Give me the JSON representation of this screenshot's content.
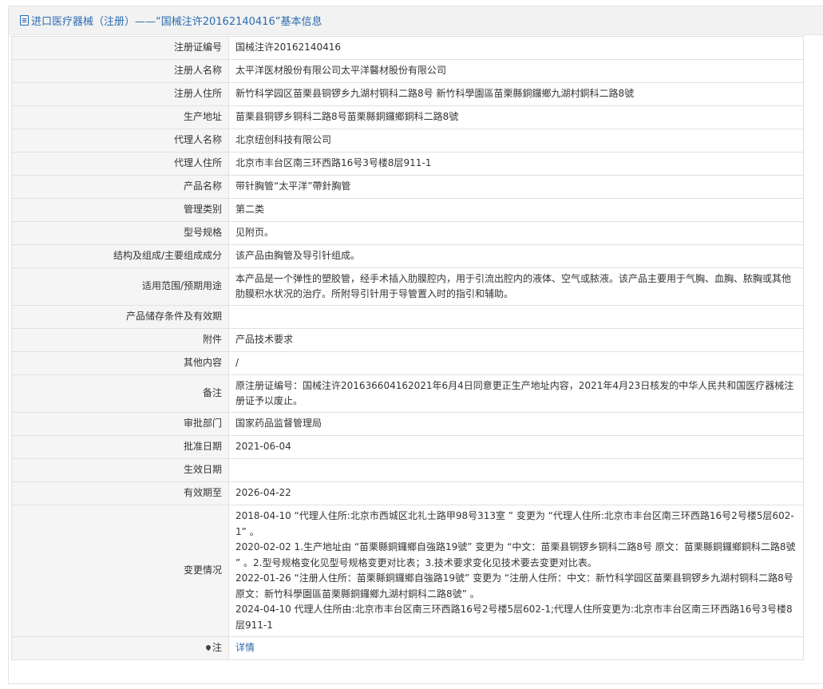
{
  "header": {
    "title": "进口医疗器械（注册）——“国械注许20162140416”基本信息"
  },
  "rows": [
    {
      "label": "注册证编号",
      "value": "国械注许20162140416"
    },
    {
      "label": "注册人名称",
      "value": "太平洋医材股份有限公司太平洋醫材股份有限公司"
    },
    {
      "label": "注册人住所",
      "value": "新竹科学园区苗栗县铜锣乡九湖村铜科二路8号 新竹科學園區苗栗縣銅鑼鄉九湖村銅科二路8號"
    },
    {
      "label": "生产地址",
      "value": "苗栗县铜锣乡铜科二路8号苗栗縣銅鑼鄉銅科二路8號"
    },
    {
      "label": "代理人名称",
      "value": "北京纽创科技有限公司"
    },
    {
      "label": "代理人住所",
      "value": "北京市丰台区南三环西路16号3号楼8层911-1"
    },
    {
      "label": "产品名称",
      "value": "带针胸管“太平洋”帶針胸管"
    },
    {
      "label": "管理类别",
      "value": "第二类"
    },
    {
      "label": "型号规格",
      "value": "见附页。"
    },
    {
      "label": "结构及组成/主要组成成分",
      "value": "该产品由胸管及导引针组成。"
    },
    {
      "label": "适用范围/预期用途",
      "value": "本产品是一个弹性的塑胶管，经手术插入肋膜腔内，用于引流出腔内的液体、空气或脓液。该产品主要用于气胸、血胸、脓胸或其他肋膜积水状况的治疗。所附导引针用于导管置入时的指引和辅助。"
    },
    {
      "label": "产品储存条件及有效期",
      "value": ""
    },
    {
      "label": "附件",
      "value": "产品技术要求"
    },
    {
      "label": "其他内容",
      "value": "/"
    },
    {
      "label": "备注",
      "value": "原注册证编号：国械注许201636604162021年6月4日同意更正生产地址内容，2021年4月23日核发的中华人民共和国医疗器械注册证予以废止。"
    },
    {
      "label": "审批部门",
      "value": "国家药品监督管理局"
    },
    {
      "label": "批准日期",
      "value": "2021-06-04"
    },
    {
      "label": "生效日期",
      "value": ""
    },
    {
      "label": "有效期至",
      "value": "2026-04-22"
    }
  ],
  "changes": {
    "label": "变更情况",
    "entries": [
      "2018-04-10 “代理人住所:北京市西城区北礼士路甲98号313室 ” 变更为 “代理人住所:北京市丰台区南三环西路16号2号楼5层602-1” 。",
      "2020-02-02 1.生产地址由 “苗栗縣銅鑼鄉自強路19號” 变更为 “中文：苗栗县铜锣乡铜科二路8号 原文：苗栗縣銅鑼鄉銅科二路8號 ” 。2.型号规格变化见型号规格变更对比表；3.技术要求变化见技术要去变更对比表。",
      "2022-01-26 “注册人住所：苗栗縣銅鑼鄉自強路19號” 变更为 “注册人住所：中文：新竹科学园区苗栗县铜锣乡九湖村铜科二路8号 原文：新竹科學園區苗栗縣銅鑼鄉九湖村銅科二路8號” 。",
      "2024-04-10 代理人住所由:北京市丰台区南三环西路16号2号楼5层602-1;代理人住所变更为:北京市丰台区南三环西路16号3号楼8层911-1"
    ]
  },
  "note": {
    "label": "注",
    "icon": "pin-icon",
    "link_text": "详情"
  }
}
